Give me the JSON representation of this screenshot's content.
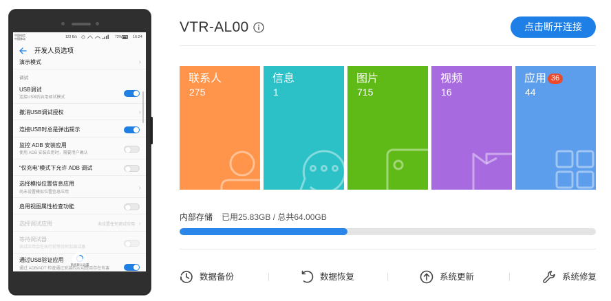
{
  "phone": {
    "status_bar": {
      "carrier_1": "中国电信",
      "carrier_2": "中国移动",
      "net_speed": "123 B/s",
      "battery": "73%",
      "time": "16:24"
    },
    "header": {
      "back_icon": "arrow-left-icon",
      "title": "开发人员选项"
    },
    "settings": {
      "demo_mode": {
        "title": "演示模式"
      },
      "section_debug": "调试",
      "usb_debugging": {
        "title": "USB调试",
        "subtitle": "连接USB后启用调试模式",
        "on": true
      },
      "revoke_usb_auth": {
        "title": "撤消USB调试授权"
      },
      "usb_prompt": {
        "title": "连接USB时总是弹出提示",
        "on": true
      },
      "monitor_adb_install": {
        "title": "监控 ADB 安装应用",
        "subtitle": "使用 ADB 安装应用时，需要用户确认",
        "on": false
      },
      "charge_only_adb": {
        "title": "“仅充电”模式下允许 ADB 调试",
        "on": false
      },
      "mock_location_app": {
        "title": "选择模拟位置信息应用",
        "subtitle": "尚未设置模拟位置信息应用"
      },
      "view_attribute_inspection": {
        "title": "启用视图属性检查功能",
        "on": false
      },
      "select_debug_app": {
        "title": "选择调试应用",
        "value": "未设置任何调试应用",
        "disabled": true
      },
      "wait_for_debugger": {
        "title": "等待调试器",
        "subtitle": "调试应用会在执行前等待附加调试器",
        "on": false,
        "disabled": true
      },
      "verify_apps_usb": {
        "title": "通过USB验证应用",
        "subtitle": "通过 ADB/ADT 检查通过安装的应用是否存在有害",
        "on": true
      }
    },
    "loading_overlay": {
      "text": "系统默认设置"
    }
  },
  "device": {
    "name": "VTR-AL00",
    "info_icon": "info-icon",
    "disconnect_label": "点击断开连接",
    "accent": "#1e80e6"
  },
  "tiles": [
    {
      "label": "联系人",
      "count": "275",
      "color": "#ff944b",
      "icon": "contacts-icon"
    },
    {
      "label": "信息",
      "count": "1",
      "color": "#2cc1c7",
      "icon": "message-icon"
    },
    {
      "label": "图片",
      "count": "715",
      "color": "#5fba17",
      "icon": "picture-icon"
    },
    {
      "label": "视频",
      "count": "16",
      "color": "#a86bdf",
      "icon": "video-icon"
    },
    {
      "label": "应用",
      "count": "44",
      "badge": "36",
      "color": "#5d9eec",
      "icon": "apps-icon"
    }
  ],
  "storage": {
    "label": "内部存储",
    "usage": "已用25.83GB / 总共64.00GB",
    "used_fraction": 0.4036,
    "fill_color": "#2a86e8"
  },
  "tools": [
    {
      "label": "数据备份",
      "icon": "backup-clock-icon"
    },
    {
      "label": "数据恢复",
      "icon": "restore-icon"
    },
    {
      "label": "系统更新",
      "icon": "update-icon"
    },
    {
      "label": "系统修复",
      "icon": "wrench-icon"
    }
  ]
}
